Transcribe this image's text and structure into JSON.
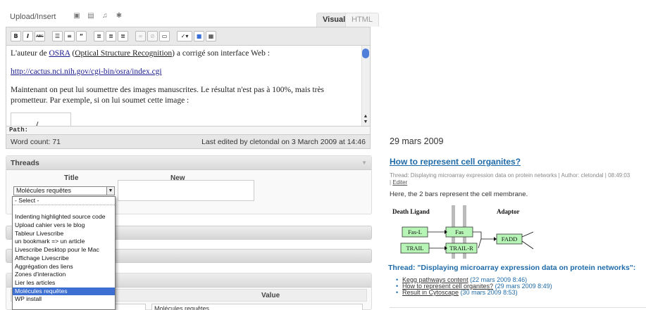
{
  "editor": {
    "upload_label": "Upload/Insert",
    "media_icons": [
      "image-icon",
      "video-icon",
      "audio-icon",
      "media-icon"
    ],
    "tabs": {
      "visual": "Visual",
      "html": "HTML"
    },
    "toolbar": {
      "bold": "B",
      "italic": "I",
      "strike": "ABC",
      "buttons": [
        "bullet-list-icon",
        "numbered-list-icon",
        "blockquote-icon",
        "align-left-icon",
        "align-center-icon",
        "align-right-icon",
        "link-icon",
        "unlink-icon",
        "more-tag-icon",
        "spellcheck-icon",
        "fullscreen-icon",
        "kitchen-sink-icon"
      ]
    },
    "content": {
      "p1_before": "L'auteur de ",
      "p1_link": "OSRA",
      "p1_mid": " (",
      "p1_underlined": "Optical Structure Recognition",
      "p1_after": ") a corrigé son interface Web :",
      "url": "http://cactus.nci.nih.gov/cgi-bin/osra/index.cgi",
      "p3": "Maintenant on peut lui soumettre des images manuscrites. Le résultat n'est pas à 100%, mais très prometteur. Par exemple, si on lui soumet cette image :"
    },
    "path_label": "Path:",
    "word_count": "Word count: 71",
    "last_edited": "Last edited by cletondal on 3 March 2009 at 14:46"
  },
  "threads": {
    "heading": "Threads",
    "col_title": "Title",
    "col_new": "New",
    "selected_value": "Molécules requêtes",
    "options": [
      "- Select -",
      "",
      "Indenting highlighted source code",
      "Upload cahier vers le blog",
      "Tableur Livescribe",
      "un bookmark => un article",
      "Livescribe Desktop pour le Mac",
      "Affichage Livescribe",
      "Aggrégation des liens",
      "Zones d'interaction",
      "Lier les articles",
      "Molécules requêtes",
      "WP install"
    ],
    "selected_index": 11
  },
  "custom_fields": {
    "value_header": "Value",
    "value_text": "Molécules requêtes"
  },
  "blog": {
    "date": "29 mars 2009",
    "post_title": "How to represent cell organites?",
    "meta": "Thread: Displaying microarray expression data on protein networks | Author: cletondal | 08:49:03",
    "edit_link": "Editer",
    "body": "Here, the 2 bars represent the cell membrane.",
    "figure": {
      "label_left": "Death Ligand",
      "label_right": "Adaptor",
      "nodes": [
        "Fas-L",
        "Fas",
        "FADD",
        "TRAIL",
        "TRAIL-R"
      ]
    },
    "thread_heading": "Thread: \"Displaying microarray expression data on protein networks\":",
    "thread_items": [
      {
        "title": "Kegg pathways content",
        "date": "(22 mars 2009 8:46)"
      },
      {
        "title": "How to represent cell organites?",
        "date": "(29 mars 2009 8:49)"
      },
      {
        "title": "Result in Cytoscape",
        "date": "(30 mars 2009 8:53)"
      }
    ]
  },
  "colors": {
    "link_blue": "#1e6aa8",
    "selection_blue": "#3d6fd3",
    "node_green": "#b6f5b6"
  }
}
